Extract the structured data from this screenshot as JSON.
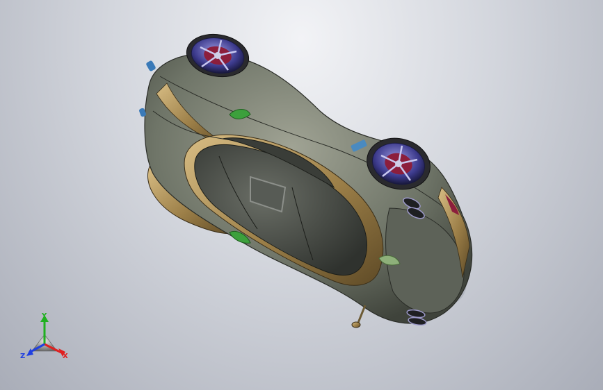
{
  "viewport": {
    "model": "car-3d-model",
    "background_top": "#f2f3f6",
    "background_bottom": "#a9adb8"
  },
  "colors": {
    "body_gold": "#8a7040",
    "body_gold_light": "#c9aa6e",
    "body_gray": "#6f7568",
    "glass": "#484c46",
    "rim": "#3c3a8c",
    "hub": "#8c1e3c",
    "marker_green": "#3ca03c",
    "axis_x": "#e02020",
    "axis_y": "#20b020",
    "axis_z": "#2040e0"
  },
  "triad": {
    "x_label": "X",
    "y_label": "Y",
    "z_label": "Z"
  }
}
